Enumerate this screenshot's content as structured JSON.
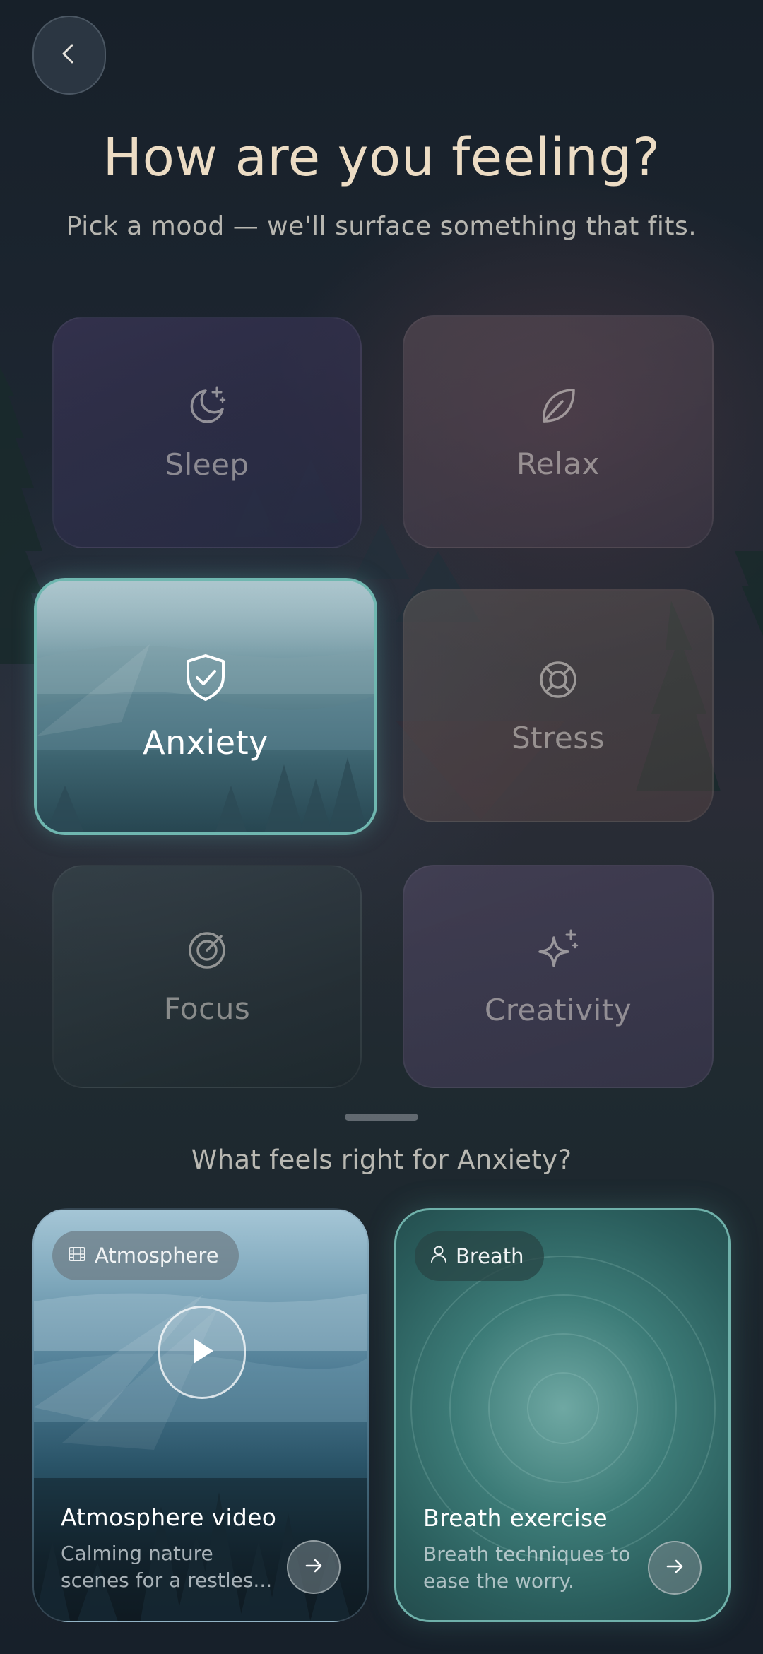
{
  "header": {
    "back_icon": "chevron-left-icon",
    "title": "How are you feeling?",
    "subtitle": "Pick a mood — we'll surface something that fits."
  },
  "moods": [
    {
      "id": "sleep",
      "label": "Sleep",
      "icon": "moon-stars-icon",
      "selected": false
    },
    {
      "id": "relax",
      "label": "Relax",
      "icon": "leaf-icon",
      "selected": false
    },
    {
      "id": "anxiety",
      "label": "Anxiety",
      "icon": "shield-check-icon",
      "selected": true
    },
    {
      "id": "stress",
      "label": "Stress",
      "icon": "lifebuoy-icon",
      "selected": false
    },
    {
      "id": "focus",
      "label": "Focus",
      "icon": "target-icon",
      "selected": false
    },
    {
      "id": "creativity",
      "label": "Creativity",
      "icon": "sparkles-icon",
      "selected": false
    }
  ],
  "suggestions": {
    "title": "What feels right for Anxiety?",
    "cards": [
      {
        "chip": "Atmosphere",
        "chip_icon": "film-icon",
        "title": "Atmosphere video",
        "description": "Calming nature scenes for a restles...",
        "action_icon": "play-icon"
      },
      {
        "chip": "Breath",
        "chip_icon": "person-icon",
        "title": "Breath exercise",
        "description": "Breath techniques to ease the worry."
      }
    ]
  },
  "colors": {
    "accent": "#6fb7b0",
    "title": "#ecdcc4",
    "background": "#18212b"
  }
}
